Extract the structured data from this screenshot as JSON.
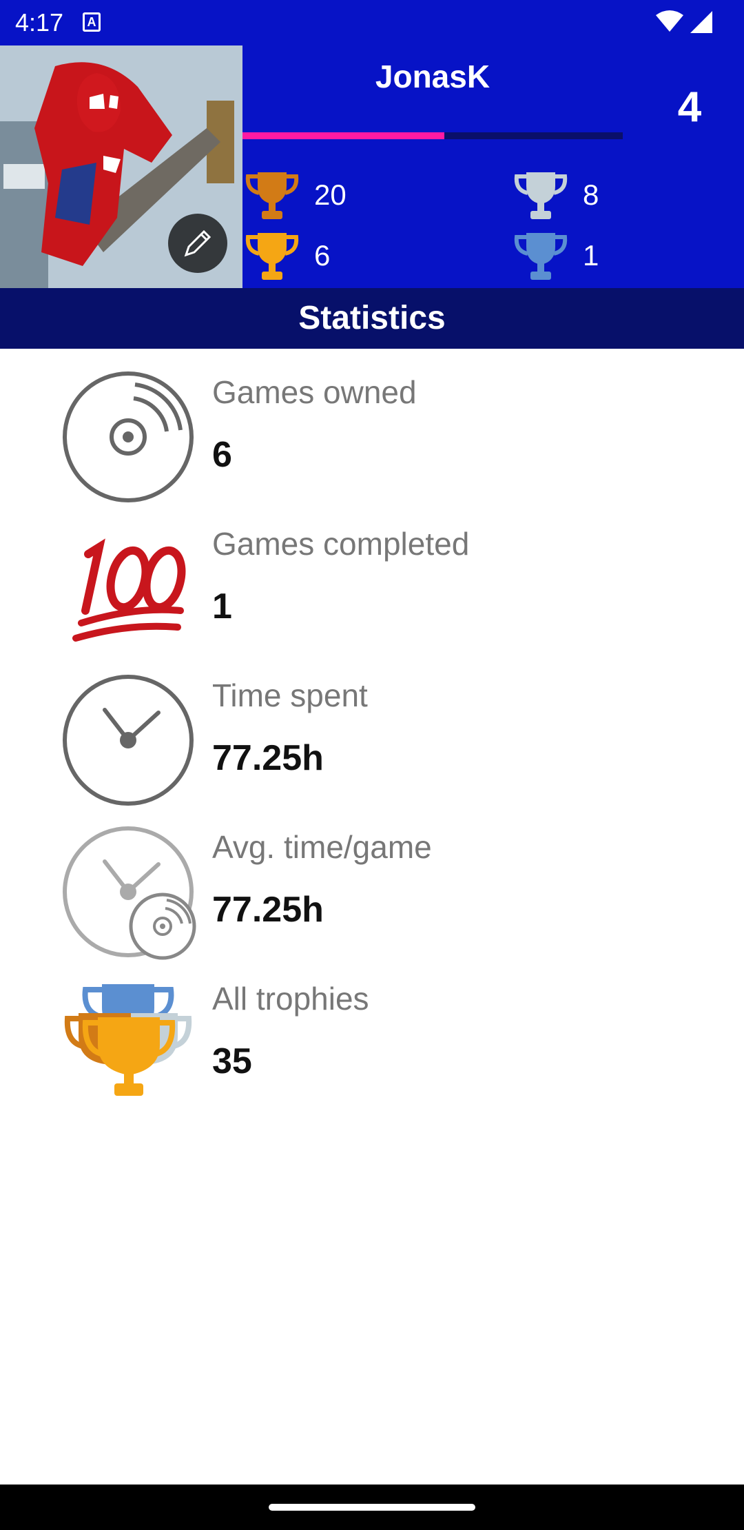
{
  "status_bar": {
    "time": "4:17",
    "notification_letter": "A"
  },
  "profile": {
    "username": "JonasK",
    "level": "4",
    "level_progress": 0.53,
    "trophies": {
      "bronze": "20",
      "silver": "8",
      "gold": "6",
      "platinum": "1"
    }
  },
  "section_title": "Statistics",
  "stats": [
    {
      "label": "Games owned",
      "value": "6",
      "icon": "disc-icon"
    },
    {
      "label": "Games completed",
      "value": "1",
      "icon": "hundred-points-icon"
    },
    {
      "label": "Time spent",
      "value": "77.25h",
      "icon": "clock-icon"
    },
    {
      "label": "Avg. time/game",
      "value": "77.25h",
      "icon": "clock-disc-icon"
    },
    {
      "label": "All trophies",
      "value": "35",
      "icon": "trophies-stack-icon"
    }
  ],
  "colors": {
    "header_bg": "#0713c6",
    "section_bg": "#07106a",
    "progress_accent": "#ff1aa3",
    "bronze": "#d27b16",
    "silver": "#c4d1d8",
    "gold": "#f5a614",
    "platinum": "#5b8fd1"
  }
}
